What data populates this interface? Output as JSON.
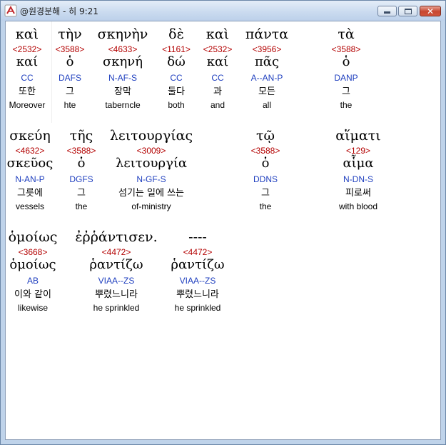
{
  "window": {
    "title": "@원경분해 - 히 9:21",
    "icon": "app-logo-icon",
    "controls": {
      "minimize": "minimize-icon",
      "maximize": "maximize-icon",
      "close": "✕"
    }
  },
  "rows": [
    {
      "words": [
        {
          "greek": "καὶ",
          "strongs": "<2532>",
          "lemma": "καί",
          "morph": "CC",
          "korean": "또한",
          "english": "Moreover"
        },
        {
          "greek": "τὴν",
          "strongs": "<3588>",
          "lemma": "ὁ",
          "morph": "DAFS",
          "korean": "그",
          "english": "hte"
        },
        {
          "greek": "σκηνὴν",
          "strongs": "<4633>",
          "lemma": "σκηνή",
          "morph": "N-AF-S",
          "korean": "장막",
          "english": "taberncle"
        },
        {
          "greek": "δὲ",
          "strongs": "<1161>",
          "lemma": "δώ",
          "morph": "CC",
          "korean": "둘다",
          "english": "both"
        },
        {
          "greek": "καὶ",
          "strongs": "<2532>",
          "lemma": "καί",
          "morph": "CC",
          "korean": "과",
          "english": "and"
        },
        {
          "greek": "πάντα",
          "strongs": "<3956>",
          "lemma": "πᾶς",
          "morph": "A--AN-P",
          "korean": "모든",
          "english": "all"
        },
        {
          "greek": "τὰ",
          "strongs": "<3588>",
          "lemma": "ὁ",
          "morph": "DANP",
          "korean": "그",
          "english": "the"
        }
      ]
    },
    {
      "words": [
        {
          "greek": "σκεύη",
          "strongs": "<4632>",
          "lemma": "σκεῦος",
          "morph": "N-AN-P",
          "korean": "그릇에",
          "english": "vessels"
        },
        {
          "greek": "τῆς",
          "strongs": "<3588>",
          "lemma": "ὁ",
          "morph": "DGFS",
          "korean": "그",
          "english": "the"
        },
        {
          "greek": "λειτουργίας",
          "strongs": "<3009>",
          "lemma": "λειτουργία",
          "morph": "N-GF-S",
          "korean": "섬기는 일에 쓰는",
          "english": "of-ministry"
        },
        {
          "greek": "τῷ",
          "strongs": "<3588>",
          "lemma": "ὁ",
          "morph": "DDNS",
          "korean": "그",
          "english": "the"
        },
        {
          "greek": "αἵματι",
          "strongs": "<129>",
          "lemma": "αἷμα",
          "morph": "N-DN-S",
          "korean": "피로써",
          "english": "with blood"
        }
      ]
    },
    {
      "words": [
        {
          "greek": "ὁμοίως",
          "strongs": "<3668>",
          "lemma": "ὁμοίως",
          "morph": "AB",
          "korean": "이와 같이",
          "english": "likewise"
        },
        {
          "greek": "ἐῤῥάντισεν.",
          "strongs": "<4472>",
          "lemma": "ῥαντίζω",
          "morph": "VIAA--ZS",
          "korean": "뿌렸느니라",
          "english": "he sprinkled"
        },
        {
          "greek": "----",
          "strongs": "<4472>",
          "lemma": "ῥαντίζω",
          "morph": "VIAA--ZS",
          "korean": "뿌렸느니라",
          "english": "he sprinkled"
        }
      ]
    }
  ],
  "colors": {
    "strongs": "#b30000",
    "morph": "#1f3fbf",
    "text": "#000000",
    "titlebar": "#c9daef",
    "client": "#ffffff"
  }
}
